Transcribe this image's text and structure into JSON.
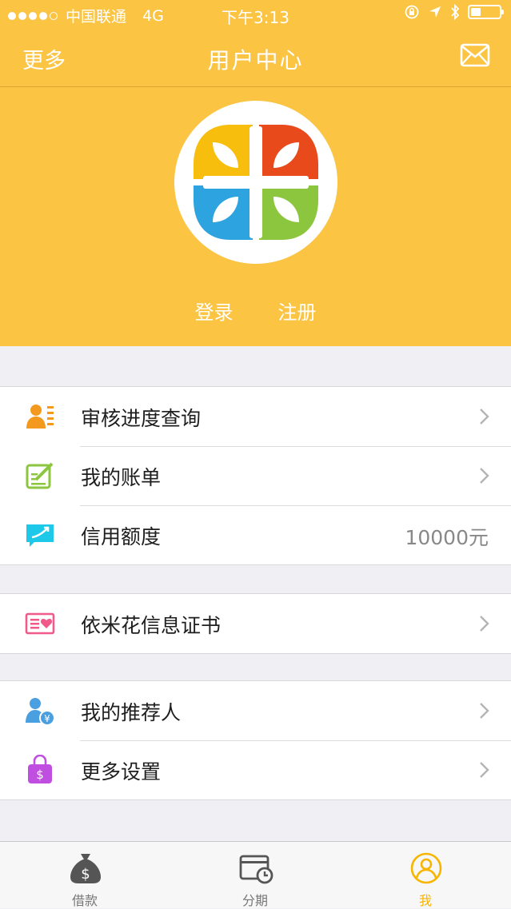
{
  "status_bar": {
    "carrier": "中国联通",
    "network": "4G",
    "time": "下午3:13"
  },
  "nav": {
    "left": "更多",
    "title": "用户中心"
  },
  "header": {
    "login": "登录",
    "register": "注册"
  },
  "groups": [
    {
      "items": [
        {
          "label": "审核进度查询",
          "icon": "review-progress-icon",
          "color": "#f39a1e"
        },
        {
          "label": "我的账单",
          "icon": "bill-icon",
          "color": "#8cc63f"
        },
        {
          "label": "信用额度",
          "icon": "credit-limit-icon",
          "color": "#1ec8e8",
          "value": "10000元"
        }
      ]
    },
    {
      "items": [
        {
          "label": "依米花信息证书",
          "icon": "certificate-icon",
          "color": "#ef5a8a"
        }
      ]
    },
    {
      "items": [
        {
          "label": "我的推荐人",
          "icon": "referrer-icon",
          "color": "#4a9fe0"
        },
        {
          "label": "更多设置",
          "icon": "settings-bag-icon",
          "color": "#c04ee0"
        }
      ]
    }
  ],
  "tabs": [
    {
      "label": "借款",
      "icon": "money-bag-icon"
    },
    {
      "label": "分期",
      "icon": "installment-icon"
    },
    {
      "label": "我",
      "icon": "user-icon",
      "active": true
    }
  ],
  "colors": {
    "brand": "#fbc443",
    "active_tab": "#f7b500"
  }
}
